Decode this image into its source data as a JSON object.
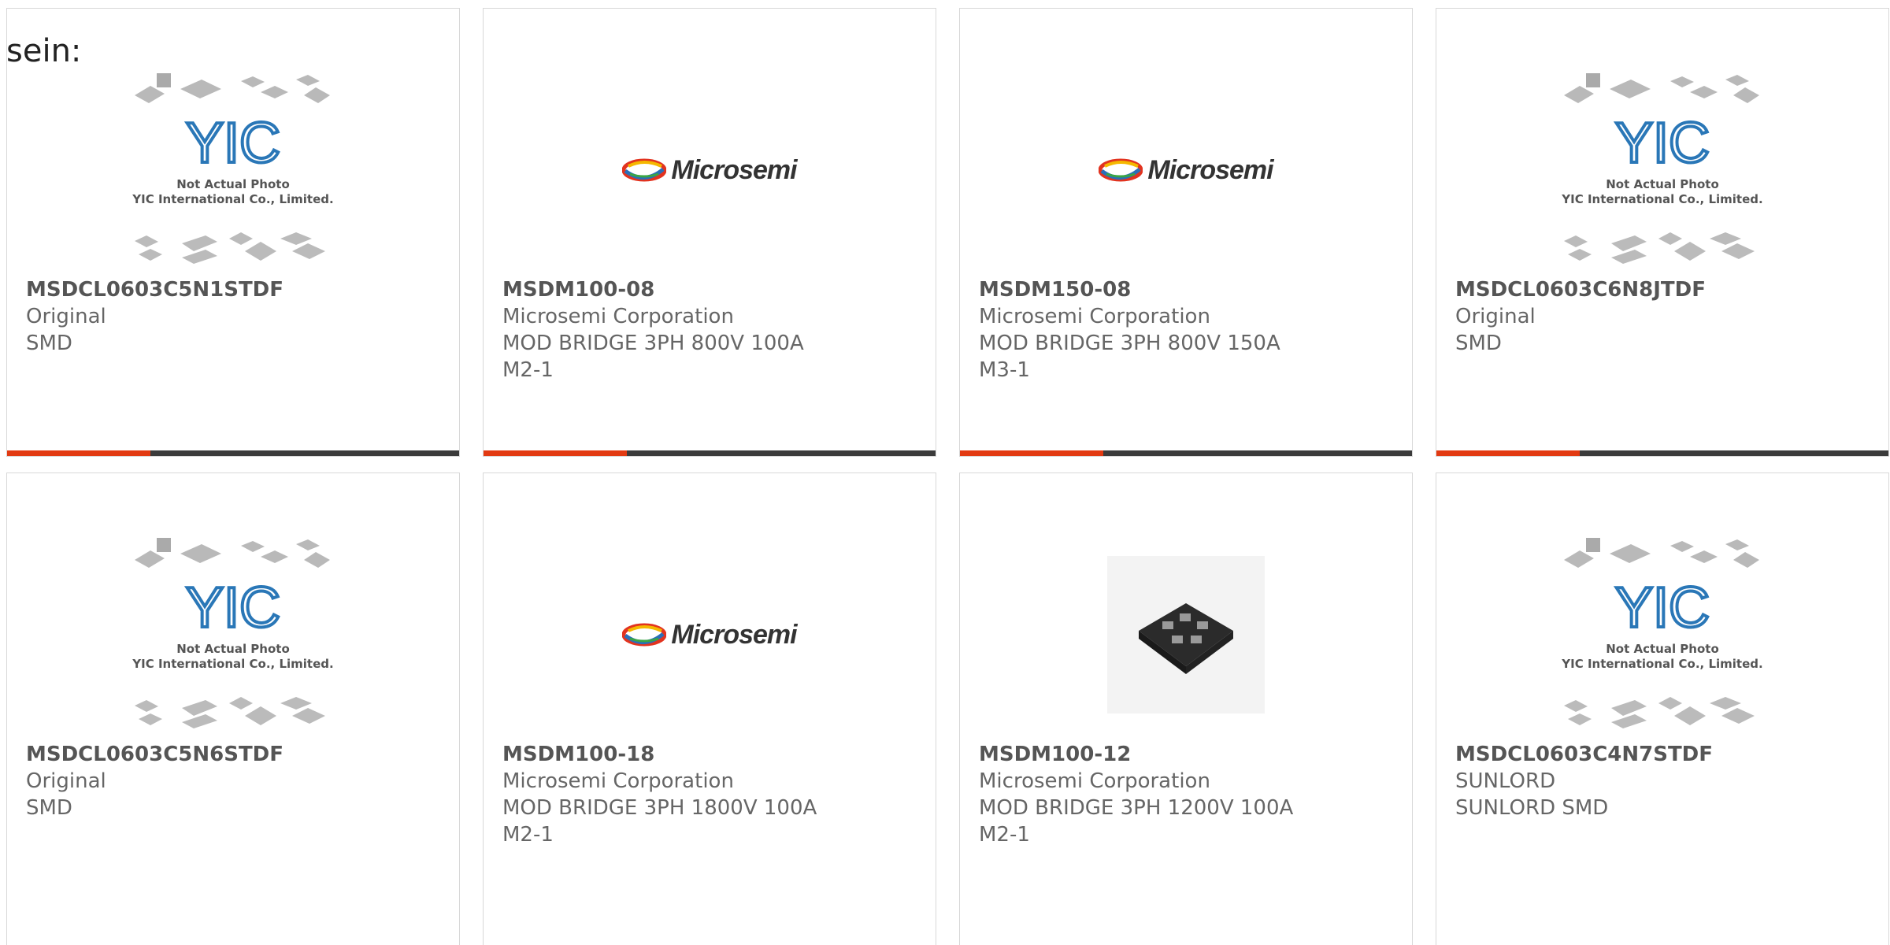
{
  "lead_text": "sein:",
  "placeholder": {
    "line1": "Not Actual Photo",
    "line2": "YIC International Co., Limited."
  },
  "brand_logo_text": "Microsemi",
  "colors": {
    "accent": "#e23a12",
    "bar": "#3b3b3b"
  },
  "products": [
    {
      "part": "MSDCL0603C5N1STDF",
      "lines": [
        "Original",
        "SMD"
      ],
      "image": "yic-placeholder"
    },
    {
      "part": "MSDM100-08",
      "lines": [
        "Microsemi Corporation",
        "MOD BRIDGE 3PH 800V 100A",
        "M2-1"
      ],
      "image": "microsemi-logo"
    },
    {
      "part": "MSDM150-08",
      "lines": [
        "Microsemi Corporation",
        "MOD BRIDGE 3PH 800V 150A",
        "M3-1"
      ],
      "image": "microsemi-logo"
    },
    {
      "part": "MSDCL0603C6N8JTDF",
      "lines": [
        "Original",
        "SMD"
      ],
      "image": "yic-placeholder"
    },
    {
      "part": "MSDCL0603C5N6STDF",
      "lines": [
        "Original",
        "SMD"
      ],
      "image": "yic-placeholder"
    },
    {
      "part": "MSDM100-18",
      "lines": [
        "Microsemi Corporation",
        "MOD BRIDGE 3PH 1800V 100A",
        "M2-1"
      ],
      "image": "microsemi-logo"
    },
    {
      "part": "MSDM100-12",
      "lines": [
        "Microsemi Corporation",
        "MOD BRIDGE 3PH 1200V 100A",
        "M2-1"
      ],
      "image": "module-photo"
    },
    {
      "part": "MSDCL0603C4N7STDF",
      "lines": [
        "SUNLORD",
        "SUNLORD SMD"
      ],
      "image": "yic-placeholder"
    }
  ]
}
